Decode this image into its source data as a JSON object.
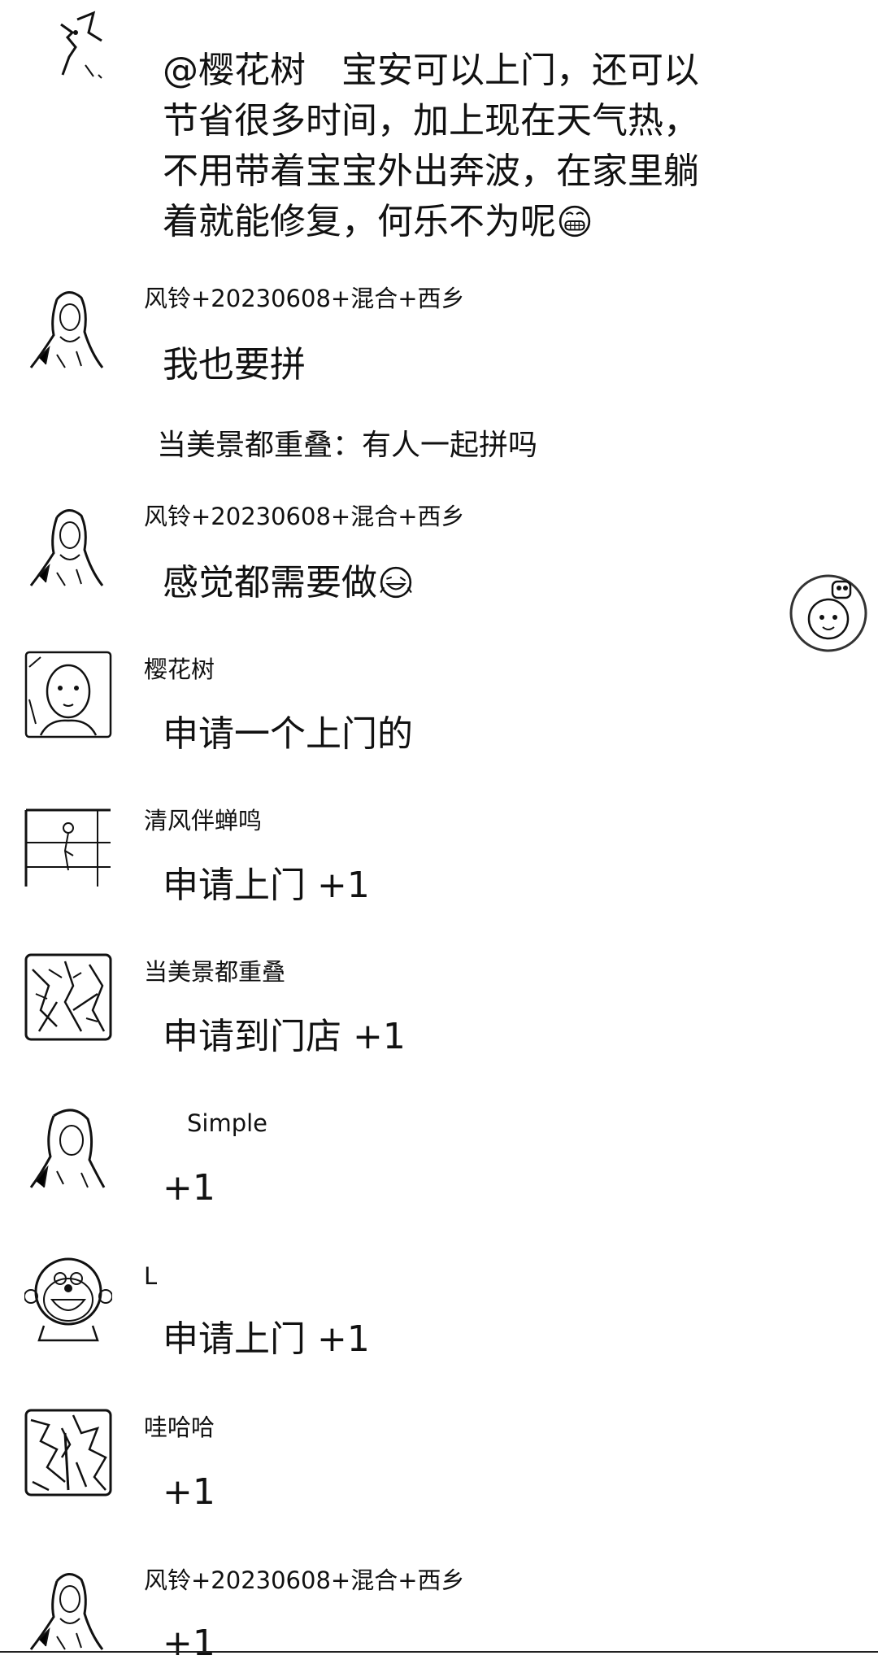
{
  "messages": [
    {
      "text": "@樱花树　宝安可以上门，还可以节省很多时间，加上现在天气热，不用带着宝宝外出奔波，在家里躺着就能修复，何乐不为呢",
      "lines": [
        "@樱花树　宝安可以上门，还可以",
        "节省很多时间，加上现在天气热，",
        "不用带着宝宝外出奔波，在家里躺",
        "着就能修复，何乐不为呢"
      ],
      "emoji": "grinning-face-icon"
    },
    {
      "name": "风铃+20230608+混合+西乡",
      "text": "我也要拼",
      "quote": "当美景都重叠：有人一起拼吗"
    },
    {
      "name": "风铃+20230608+混合+西乡",
      "text": "感觉都需要做",
      "emoji": "laughing-face-icon"
    },
    {
      "name": "樱花树",
      "text": "申请一个上门的"
    },
    {
      "name": "清风伴蝉鸣",
      "text": "申请上门 +1"
    },
    {
      "name": "当美景都重叠",
      "text": "申请到门店 +1"
    },
    {
      "name": "Simple",
      "text": "+1"
    },
    {
      "name": "L",
      "text": "申请上门 +1"
    },
    {
      "name": "哇哈哈",
      "text": "+1"
    },
    {
      "name": "风铃+20230608+混合+西乡",
      "text": "+1"
    }
  ],
  "icons": {
    "floating_button": "cartoon-kid-icon"
  }
}
